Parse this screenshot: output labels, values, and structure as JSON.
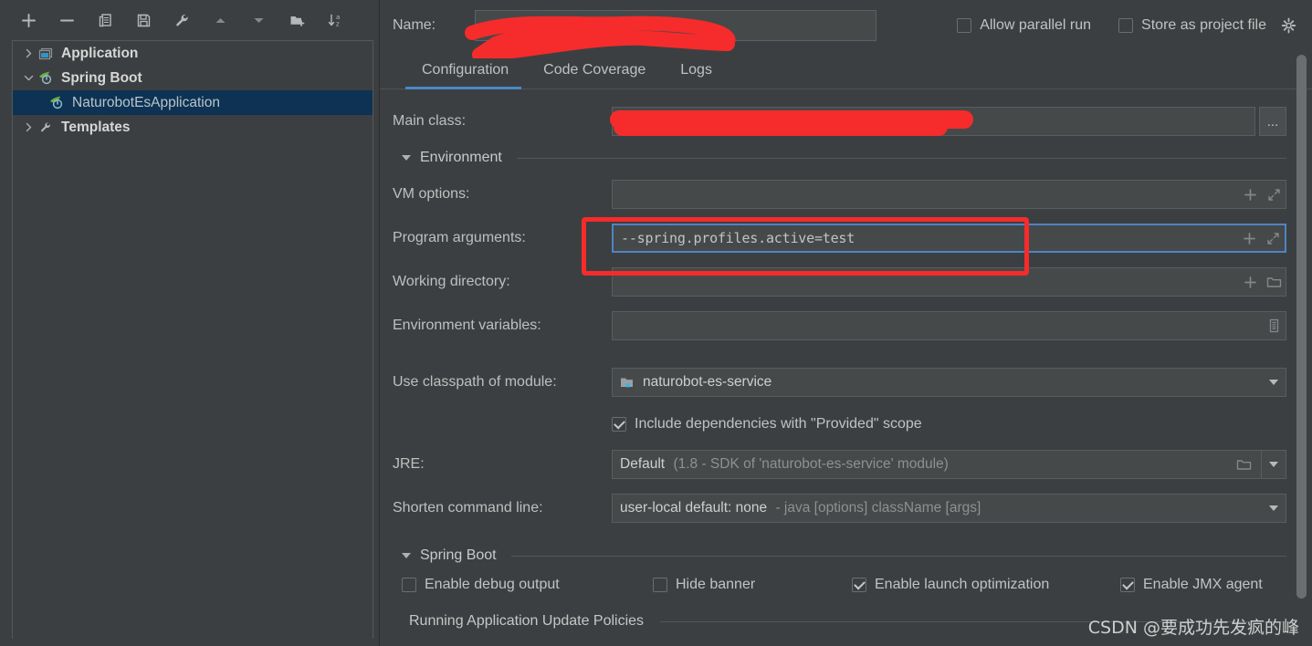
{
  "toolbar": {
    "buttons": [
      {
        "name": "add-button",
        "icon": "plus-icon",
        "title": "Add New Configuration"
      },
      {
        "name": "remove-button",
        "icon": "minus-icon",
        "title": "Remove Configuration"
      },
      {
        "name": "copy-button",
        "icon": "copy-icon",
        "title": "Copy Configuration"
      },
      {
        "name": "save-button",
        "icon": "save-icon",
        "title": "Save Configuration"
      },
      {
        "name": "edit-templates-button",
        "icon": "wrench-icon",
        "title": "Edit Templates"
      },
      {
        "name": "move-up-button",
        "icon": "arrow-up-icon",
        "title": "Move Up"
      },
      {
        "name": "move-down-button",
        "icon": "arrow-down-icon",
        "title": "Move Down"
      },
      {
        "name": "new-folder-button",
        "icon": "new-folder-icon",
        "title": "Create New Folder"
      },
      {
        "name": "sort-button",
        "icon": "sort-az-icon",
        "title": "Sort Configurations"
      }
    ]
  },
  "tree": {
    "items": [
      {
        "label": "Application",
        "icon": "application-icon",
        "expanded": false,
        "level": 0,
        "selected": false
      },
      {
        "label": "Spring Boot",
        "icon": "spring-boot-icon",
        "expanded": true,
        "level": 0,
        "selected": false
      },
      {
        "label": "NaturobotEsApplication",
        "icon": "spring-boot-icon",
        "expanded": null,
        "level": 1,
        "selected": true
      },
      {
        "label": "Templates",
        "icon": "wrench-icon",
        "expanded": false,
        "level": 0,
        "selected": false
      }
    ]
  },
  "header": {
    "name_label": "Name:",
    "name_value": "",
    "name_redacted": true,
    "allow_parallel_run": {
      "label": "Allow parallel run",
      "checked": false
    },
    "store_as_project_file": {
      "label": "Store as project file",
      "checked": false
    },
    "settings_icon": "gear-icon"
  },
  "tabs": [
    {
      "label": "Configuration",
      "active": true
    },
    {
      "label": "Code Coverage",
      "active": false
    },
    {
      "label": "Logs",
      "active": false
    }
  ],
  "form": {
    "main_class": {
      "label": "Main class:",
      "value": "",
      "redacted": true,
      "browse_label": "..."
    },
    "environment_section": {
      "label": "Environment",
      "expanded": true
    },
    "vm_options": {
      "label": "VM options:",
      "value": "",
      "icons": [
        "plus-icon",
        "expand-icon"
      ]
    },
    "program_arguments": {
      "label": "Program arguments:",
      "value": "--spring.profiles.active=test",
      "focused": true,
      "highlighted": true,
      "icons": [
        "plus-icon",
        "expand-icon"
      ]
    },
    "working_directory": {
      "label": "Working directory:",
      "value": "",
      "icons": [
        "plus-icon",
        "folder-icon"
      ]
    },
    "environment_variables": {
      "label": "Environment variables:",
      "value": "",
      "icons": [
        "list-icon"
      ]
    },
    "use_classpath_of_module": {
      "label": "Use classpath of module:",
      "value": "naturobot-es-service",
      "icon": "module-icon"
    },
    "include_provided_scope": {
      "label": "Include dependencies with \"Provided\" scope",
      "checked": true
    },
    "jre": {
      "label": "JRE:",
      "value": "Default",
      "value_detail": "(1.8 - SDK of 'naturobot-es-service' module)",
      "icons": [
        "folder-icon",
        "chevron-down-icon"
      ]
    },
    "shorten_command_line": {
      "label": "Shorten command line:",
      "value": "user-local default: none",
      "value_detail": "- java [options] className [args]",
      "icons": [
        "chevron-down-icon"
      ]
    },
    "spring_boot_section": {
      "label": "Spring Boot",
      "expanded": true
    },
    "spring_boot_checks": [
      {
        "label": "Enable debug output",
        "checked": false
      },
      {
        "label": "Hide banner",
        "checked": false
      },
      {
        "label": "Enable launch optimization",
        "checked": true
      },
      {
        "label": "Enable JMX agent",
        "checked": true
      }
    ],
    "policies_section": {
      "label": "Running Application Update Policies"
    }
  },
  "watermark": {
    "text": "CSDN @要成功先发疯的峰"
  },
  "colors": {
    "background": "#3c3f41",
    "field_background": "#45494a",
    "selection": "#0d3253",
    "accent_blue": "#4a88c7",
    "annotation_red": "#f62b2b",
    "text": "#bbbbbb",
    "muted_text": "#8e9192",
    "spring_green": "#6cae3e",
    "module_cyan": "#3fb3dd"
  }
}
